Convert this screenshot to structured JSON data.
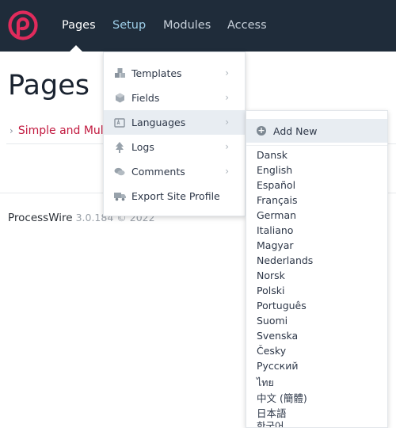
{
  "header": {
    "logo_icon": "processwire-logo",
    "brand_color": "#e02b5c",
    "nav": [
      {
        "label": "Pages"
      },
      {
        "label": "Setup"
      },
      {
        "label": "Modules"
      },
      {
        "label": "Access"
      }
    ]
  },
  "main": {
    "title": "Pages",
    "tree_item": "Simple and Mult",
    "footer_brand": "ProcessWire",
    "footer_version": "3.0.184 © 2022"
  },
  "setup_menu": {
    "items": [
      {
        "label": "Templates",
        "icon": "cubes-icon"
      },
      {
        "label": "Fields",
        "icon": "cube-icon"
      },
      {
        "label": "Languages",
        "icon": "language-icon"
      },
      {
        "label": "Logs",
        "icon": "tree-icon"
      },
      {
        "label": "Comments",
        "icon": "comments-icon"
      },
      {
        "label": "Export Site Profile",
        "icon": "truck-icon"
      }
    ]
  },
  "languages_menu": {
    "add_new": "Add New",
    "languages": [
      "Dansk",
      "English",
      "Español",
      "Français",
      "German",
      "Italiano",
      "Magyar",
      "Nederlands",
      "Norsk",
      "Polski",
      "Português",
      "Suomi",
      "Svenska",
      "Česky",
      "Русский",
      "ไทย",
      "中文 (簡體)",
      "日本語",
      "한국어"
    ]
  }
}
